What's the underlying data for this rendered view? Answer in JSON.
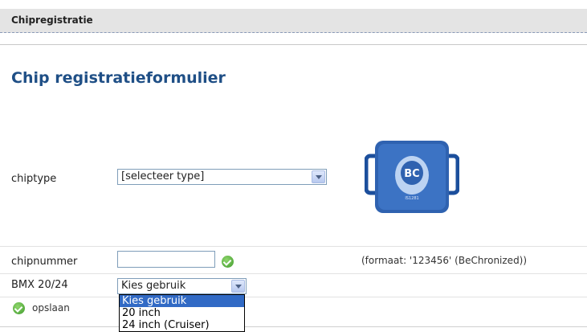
{
  "header": {
    "title": "Chipregistratie"
  },
  "page": {
    "heading": "Chip registratieformulier"
  },
  "form": {
    "chiptype": {
      "label": "chiptype",
      "selected": "[selecteer type]"
    },
    "chipnummer": {
      "label": "chipnummer",
      "value": "",
      "format_hint": "(formaat: '123456' (BeChronized))"
    },
    "bmx": {
      "label": "BMX 20/24",
      "selected": "Kies gebruik",
      "options": [
        "Kies gebruik",
        "20 inch",
        "24 inch (Cruiser)"
      ]
    },
    "save_label": "opslaan"
  },
  "chip_image": {
    "badge_text": "BC",
    "serial_text": "IS1281"
  },
  "colors": {
    "heading": "#1f4f86",
    "chip_blue": "#2f62b0",
    "check_green": "#3f9a2c",
    "option_highlight": "#316ac5"
  },
  "icons": {
    "valid": "check-circle-icon",
    "save": "check-circle-icon",
    "dropdown": "chevron-down-icon"
  }
}
